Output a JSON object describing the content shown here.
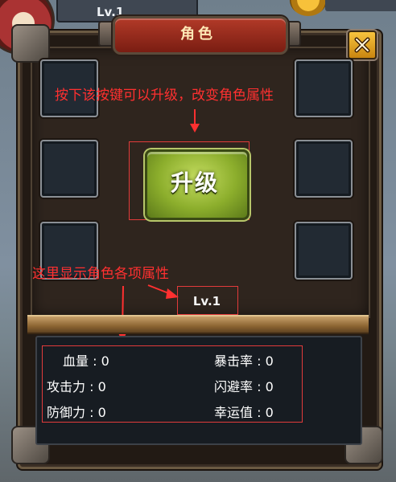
{
  "background": {
    "level_label": "Lv.1"
  },
  "window": {
    "title": "角色",
    "close_icon": "close-x-icon"
  },
  "upgrade": {
    "label": "升级"
  },
  "annotations": {
    "upgrade_hint": "按下该按键可以升级，改变角色属性",
    "stats_hint": "这里显示角色各项属性"
  },
  "level": {
    "text": "Lv.1"
  },
  "stats": {
    "left": [
      {
        "label": "血量 : 0"
      },
      {
        "label": "攻击力 : 0"
      },
      {
        "label": "防御力 : 0"
      }
    ],
    "right": [
      {
        "label": "暴击率 : 0"
      },
      {
        "label": "闪避率 : 0"
      },
      {
        "label": "幸运值 : 0"
      }
    ]
  },
  "colors": {
    "annotation": "#ff3030",
    "button_green": "#8cae2c",
    "title_red": "#b23a28",
    "close_gold": "#f7c43e"
  }
}
